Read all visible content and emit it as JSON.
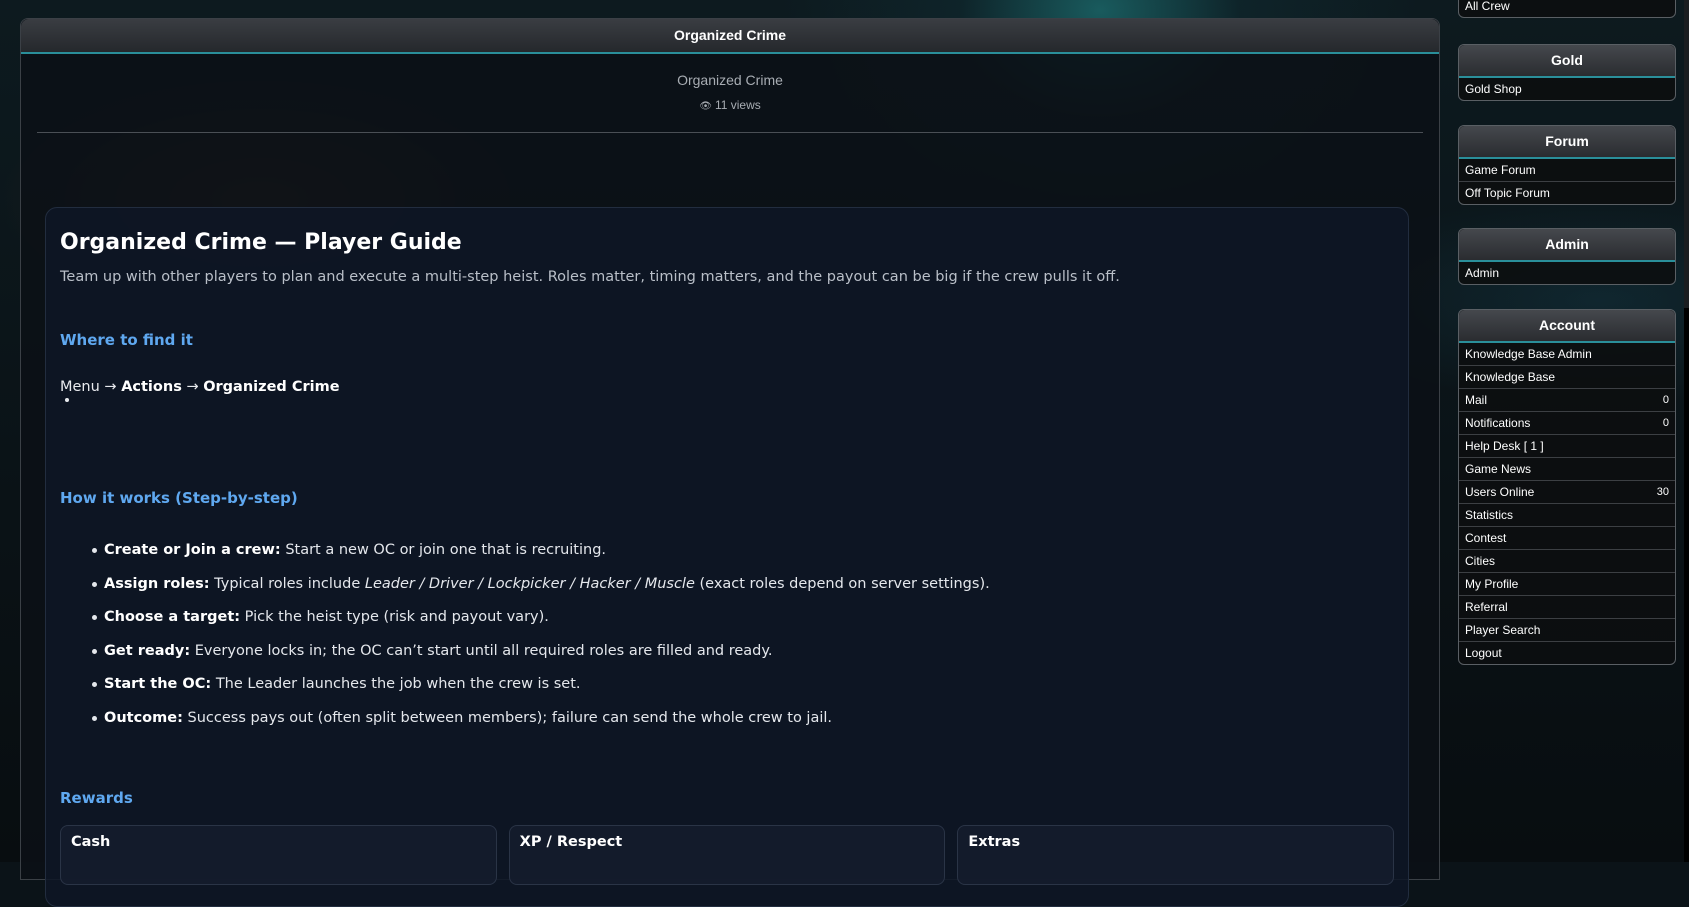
{
  "main": {
    "header_title": "Organized Crime",
    "page_title": "Organized Crime",
    "views_text": "11 views"
  },
  "guide": {
    "title": "Organized Crime — Player Guide",
    "intro": "Team up with other players to plan and execute a multi-step heist. Roles matter, timing matters, and the payout can be big if the crew pulls it off.",
    "where_heading": "Where to find it",
    "menu_path": {
      "menu": "Menu",
      "arrow": "→",
      "actions": "Actions",
      "organized_crime": "Organized Crime"
    },
    "how_heading": "How it works (Step-by-step)",
    "steps": [
      {
        "label": "Create or Join a crew:",
        "text": "Start a new OC or join one that is recruiting."
      },
      {
        "label": "Assign roles:",
        "text_before": "Typical roles include",
        "roles": "Leader / Driver / Lockpicker / Hacker / Muscle",
        "text_after": "(exact roles depend on server settings)."
      },
      {
        "label": "Choose a target:",
        "text": "Pick the heist type (risk and payout vary)."
      },
      {
        "label": "Get ready:",
        "text": "Everyone locks in; the OC can’t start until all required roles are filled and ready."
      },
      {
        "label": "Start the OC:",
        "text": "The Leader launches the job when the crew is set."
      },
      {
        "label": "Outcome:",
        "text": "Success pays out (often split between members); failure can send the whole crew to jail."
      }
    ],
    "rewards_heading": "Rewards",
    "reward_cards": [
      "Cash",
      "XP / Respect",
      "Extras"
    ]
  },
  "sidebar": {
    "crew_partial": {
      "items": [
        {
          "label": "All Crew"
        }
      ]
    },
    "gold": {
      "title": "Gold",
      "items": [
        {
          "label": "Gold Shop"
        }
      ]
    },
    "forum": {
      "title": "Forum",
      "items": [
        {
          "label": "Game Forum"
        },
        {
          "label": "Off Topic Forum"
        }
      ]
    },
    "admin": {
      "title": "Admin",
      "items": [
        {
          "label": "Admin"
        }
      ]
    },
    "account": {
      "title": "Account",
      "items": [
        {
          "label": "Knowledge Base Admin",
          "count": ""
        },
        {
          "label": "Knowledge Base",
          "count": ""
        },
        {
          "label": "Mail",
          "count": "0"
        },
        {
          "label": "Notifications",
          "count": "0"
        },
        {
          "label": "Help Desk [ 1 ]",
          "count": ""
        },
        {
          "label": "Game News",
          "count": ""
        },
        {
          "label": "Users Online",
          "count": "30"
        },
        {
          "label": "Statistics",
          "count": ""
        },
        {
          "label": "Contest",
          "count": ""
        },
        {
          "label": "Cities",
          "count": ""
        },
        {
          "label": "My Profile",
          "count": ""
        },
        {
          "label": "Referral",
          "count": ""
        },
        {
          "label": "Player Search",
          "count": ""
        },
        {
          "label": "Logout",
          "count": ""
        }
      ]
    }
  },
  "colors": {
    "accent_teal": "#2a8f9a",
    "heading_blue": "#5fa8f0"
  },
  "icons": {
    "views": "eye-icon"
  }
}
